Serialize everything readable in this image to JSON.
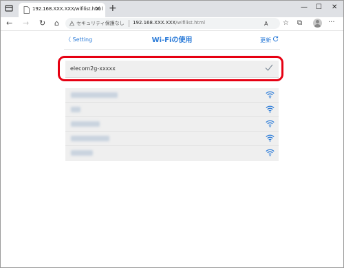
{
  "browser": {
    "tab_title": "192.168.XXX.XXX/wifilist.html",
    "tab_close": "✕",
    "new_tab": "+",
    "window_controls": {
      "minimize": "—",
      "maximize": "☐",
      "close": "✕"
    },
    "nav": {
      "back": "←",
      "forward": "→",
      "reload": "↻",
      "home": "⌂"
    },
    "address": {
      "security_text": "セキュリティ保護なし",
      "host": "192.168.XXX.XXX",
      "path": "/wifilist.html"
    },
    "toolbar_icons": {
      "read_aloud": "A",
      "favorites": "☆",
      "collections": "⧉",
      "more": "···"
    }
  },
  "page": {
    "back_label": "Setting",
    "title": "Wi-Fiの使用",
    "refresh_label": "更新",
    "connected_network": {
      "ssid": "elecom2g-xxxxx",
      "selected": true
    },
    "other_networks": [
      {
        "name_obscured": true
      },
      {
        "name_obscured": true
      },
      {
        "name_obscured": true
      },
      {
        "name_obscured": true
      },
      {
        "name_obscured": true
      }
    ]
  },
  "colors": {
    "accent": "#2b7bd8",
    "highlight": "#e60012",
    "row_bg": "#efefef"
  }
}
